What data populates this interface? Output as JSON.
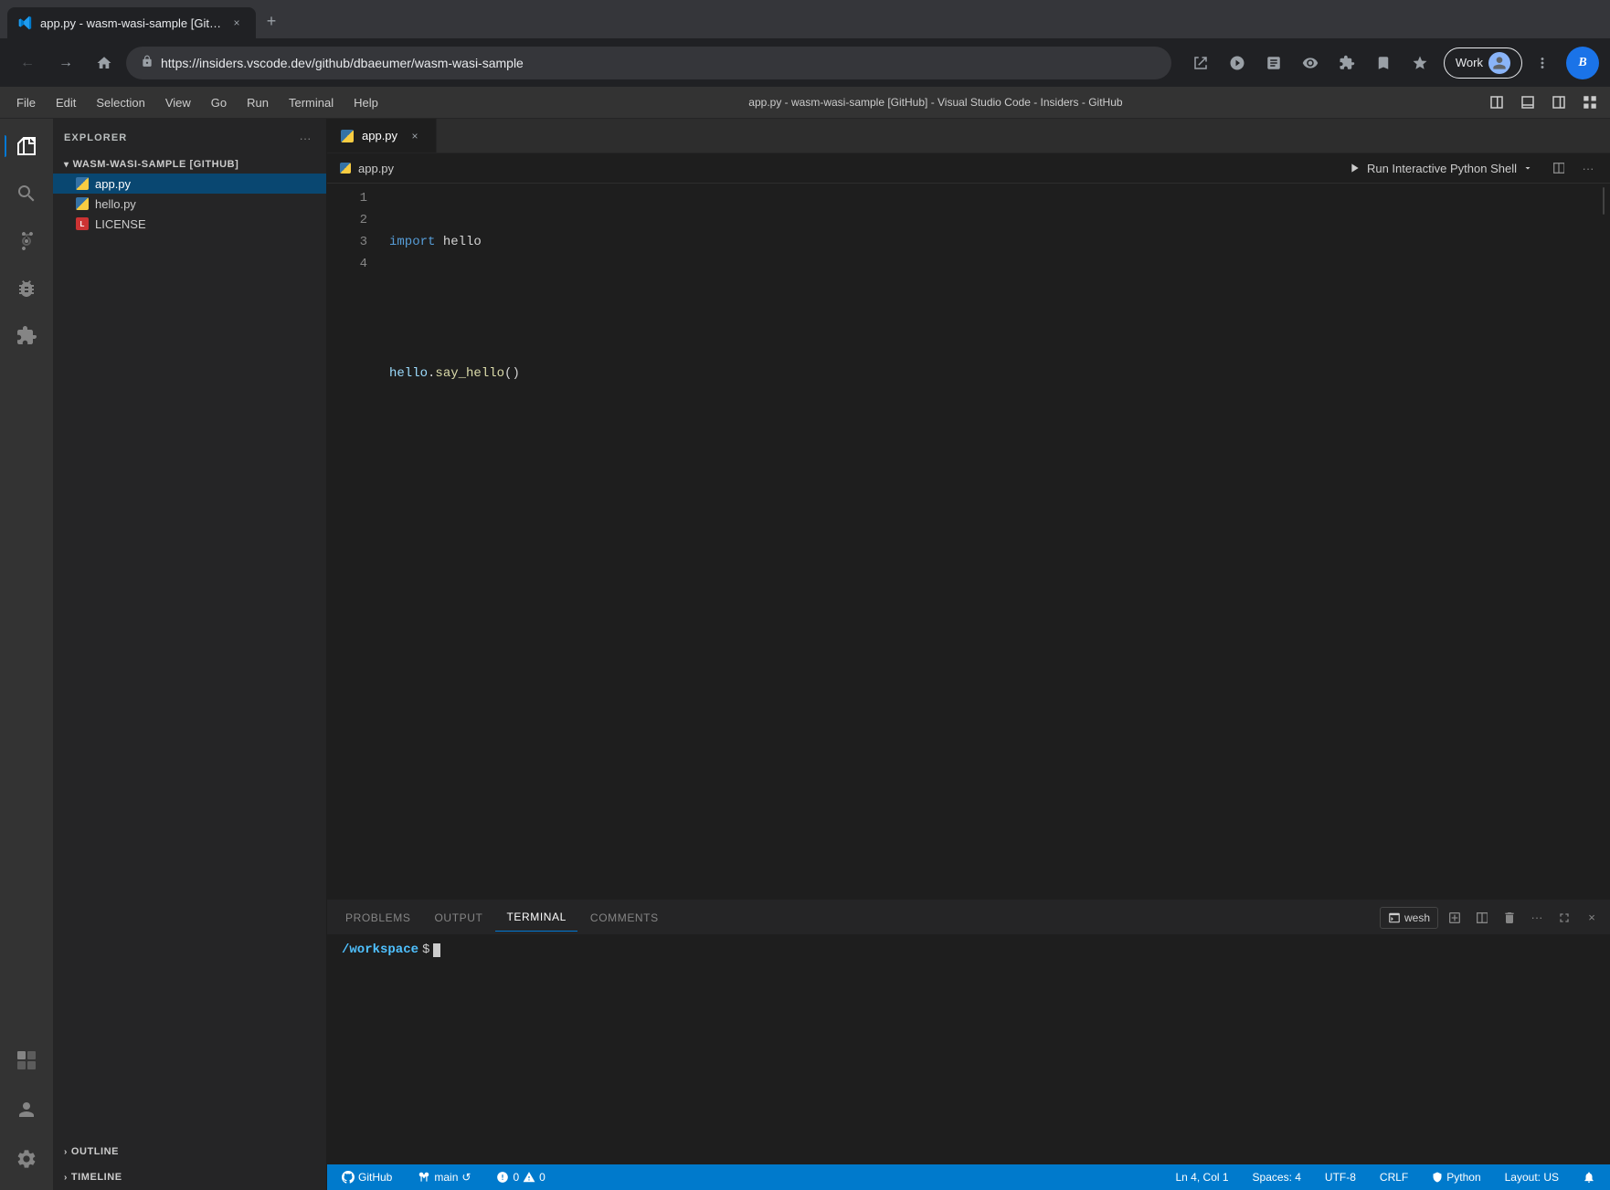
{
  "browser": {
    "tab_title": "app.py - wasm-wasi-sample [Git…",
    "tab_close": "×",
    "new_tab": "+",
    "url": "https://insiders.vscode.dev/github/dbaeumer/wasm-wasi-sample",
    "profile_label": "Work",
    "back_btn": "←",
    "forward_btn": "→",
    "home_btn": "⌂",
    "refresh_btn": "↻",
    "copilot_label": "B"
  },
  "menubar": {
    "items": [
      "File",
      "Edit",
      "Selection",
      "View",
      "Go",
      "Run",
      "Terminal",
      "Help"
    ],
    "title": "app.py - wasm-wasi-sample [GitHub] - Visual Studio Code - Insiders - GitHub",
    "layout_icons": [
      "⊟",
      "⊞",
      "▣",
      "⋮⋮"
    ]
  },
  "sidebar": {
    "title": "EXPLORER",
    "more_actions": "···",
    "project_name": "WASM-WASI-SAMPLE [GITHUB]",
    "files": [
      {
        "name": "app.py",
        "type": "py",
        "active": true
      },
      {
        "name": "hello.py",
        "type": "py",
        "active": false
      },
      {
        "name": "LICENSE",
        "type": "license",
        "active": false
      }
    ],
    "outline_label": "OUTLINE",
    "timeline_label": "TIMELINE"
  },
  "activity": {
    "items": [
      "explorer",
      "search",
      "source-control",
      "debug",
      "extensions",
      "remote",
      "github"
    ]
  },
  "editor": {
    "tab_filename": "app.py",
    "breadcrumb": "app.py",
    "run_interactive_label": "Run Interactive Python Shell",
    "code_lines": [
      {
        "num": 1,
        "content": "import hello"
      },
      {
        "num": 2,
        "content": ""
      },
      {
        "num": 3,
        "content": "hello.say_hello()"
      },
      {
        "num": 4,
        "content": ""
      }
    ]
  },
  "panel": {
    "tabs": [
      {
        "label": "PROBLEMS",
        "active": false
      },
      {
        "label": "OUTPUT",
        "active": false
      },
      {
        "label": "TERMINAL",
        "active": true
      },
      {
        "label": "COMMENTS",
        "active": false
      }
    ],
    "shell_name": "wesh",
    "terminal_path": "/workspace",
    "terminal_prompt": "$"
  },
  "statusbar": {
    "github_label": "GitHub",
    "branch_label": "main",
    "sync_icon": "↺",
    "errors": "0",
    "warnings": "0",
    "ln_col": "Ln 4, Col 1",
    "spaces": "Spaces: 4",
    "encoding": "UTF-8",
    "line_ending": "CRLF",
    "language": "Python",
    "layout": "Layout: US",
    "notification_icon": "🔔"
  }
}
